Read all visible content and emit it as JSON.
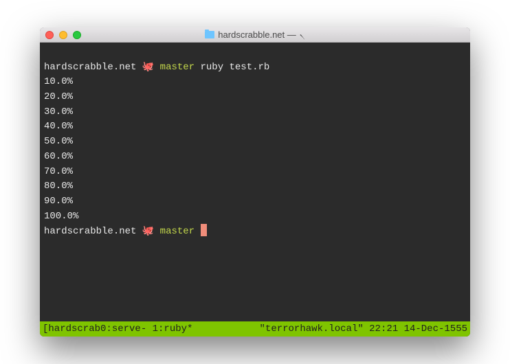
{
  "window": {
    "title_prefix": "hardscrabble.net —",
    "title_suffix": "৲"
  },
  "prompt1": {
    "host": "hardscrabble.net",
    "icon": "🐙",
    "branch": "master",
    "command": "ruby test.rb"
  },
  "output": [
    "10.0%",
    "20.0%",
    "30.0%",
    "40.0%",
    "50.0%",
    "60.0%",
    "70.0%",
    "80.0%",
    "90.0%",
    "100.0%"
  ],
  "prompt2": {
    "host": "hardscrabble.net",
    "icon": "🐙",
    "branch": "master"
  },
  "status": {
    "left": "[hardscrab0:serve- 1:ruby*",
    "host": "\"terrorhawk.local\"",
    "time": "22:21",
    "date": "14-Dec-1555"
  },
  "colors": {
    "bg": "#2b2b2b",
    "fg": "#e8e8e8",
    "branch": "#c4d84b",
    "cursor": "#f08d7a",
    "status_bg": "#7fc400"
  }
}
